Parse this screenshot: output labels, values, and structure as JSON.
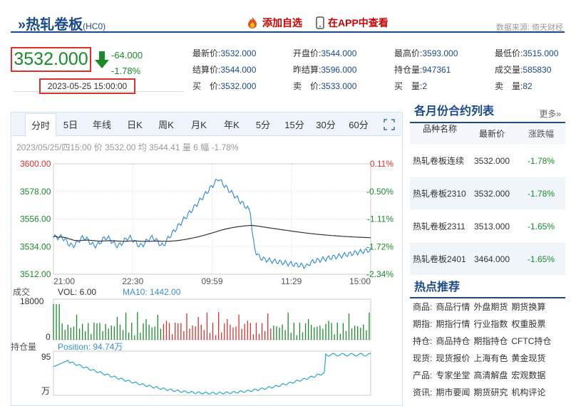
{
  "header": {
    "title": "热轧卷板",
    "code": "(HC0)",
    "favorite_label": "添加自选",
    "app_label": "在APP中查看",
    "source": "数据来源: 倚天财经"
  },
  "price": {
    "last": "3532.000",
    "change": "-64.000",
    "change_pct": "-1.78%",
    "datetime": "2023-05-25 15:00:00"
  },
  "quote": [
    {
      "label": "最新价:",
      "value": "3532.000"
    },
    {
      "label": "开盘价:",
      "value": "3544.000"
    },
    {
      "label": "最高价:",
      "value": "3593.000"
    },
    {
      "label": "最低价:",
      "value": "3515.000"
    },
    {
      "label": "结算价:",
      "value": "3544.000"
    },
    {
      "label": "昨结算:",
      "value": "3596.000"
    },
    {
      "label": "持仓量:",
      "value": "947361"
    },
    {
      "label": "成交量:",
      "value": "585830"
    },
    {
      "label": "买　价:",
      "value": "3532.000"
    },
    {
      "label": "卖　价:",
      "value": "3533.000"
    },
    {
      "label": "买　量:",
      "value": "2"
    },
    {
      "label": "卖　量:",
      "value": "82"
    }
  ],
  "tabs": [
    "分时",
    "5日",
    "年线",
    "日K",
    "周K",
    "月K",
    "年K",
    "5分",
    "15分",
    "30分",
    "60分"
  ],
  "chart_info": "2023/05/25/四15:00 价 3532.00 均 3544.41 量 6 幅 -1.78%",
  "chart": {
    "y_left": [
      "3600.00",
      "3578.00",
      "3556.00",
      "3534.00",
      "3512.00"
    ],
    "y_right": [
      "0.11%",
      "-0.50%",
      "-1.11%",
      "-1.72%",
      "-2.34%"
    ],
    "x_labels": [
      "21:00",
      "22:30",
      "09:59",
      "11:29",
      "15:00"
    ],
    "vol_label": "成交",
    "vol_text": "VOL: 6.00",
    "ma_text": "MA10: 1442.00",
    "vol_max": "18000",
    "vol_zero": "0",
    "pos_label": "持仓量",
    "pos_text": "Position: 94.74万",
    "pos_tick": "95",
    "pos_unit": "万",
    "colors": {
      "price": "#3a8fd8",
      "avg": "#333333",
      "up": "#d9322e",
      "down": "#1a8a2a"
    }
  },
  "contracts": {
    "title": "各月份合约列表",
    "more": "更多»",
    "headers": [
      "品种名称",
      "最新价",
      "涨跌幅"
    ],
    "rows": [
      {
        "name": "热轧卷板连续",
        "price": "3532.000",
        "pct": "-1.78%"
      },
      {
        "name": "热轧卷板2310",
        "price": "3532.000",
        "pct": "-1.78%"
      },
      {
        "name": "热轧卷板2311",
        "price": "3513.000",
        "pct": "-1.65%"
      },
      {
        "name": "热轧卷板2401",
        "price": "3464.000",
        "pct": "-1.65%"
      }
    ]
  },
  "hot": {
    "title": "热点推荐",
    "rows": [
      [
        "商品:",
        "商品行情",
        "外盘期货",
        "期货换算"
      ],
      [
        "期指:",
        "期指行情",
        "行业指数",
        "权重股票"
      ],
      [
        "持仓:",
        "商品持仓",
        "期指持仓",
        "CFTC持仓"
      ],
      [
        "现货:",
        "现货报价",
        "上海有色",
        "黄金现货"
      ],
      [
        "产品:",
        "专家坐堂",
        "高清解盘",
        "宏观数据"
      ],
      [
        "资讯:",
        "期市要闻",
        "期货研究",
        "机构评论"
      ]
    ]
  }
}
